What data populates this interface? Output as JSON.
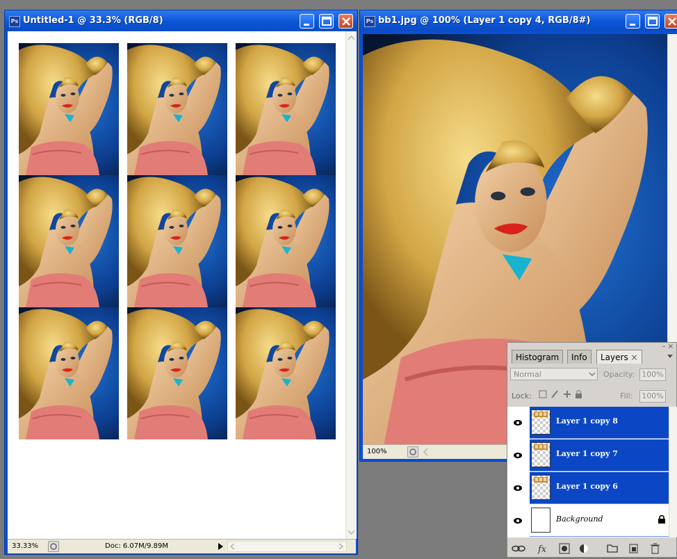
{
  "window_left": {
    "title": "Untitled-1 @ 33.3% (RGB/8)",
    "zoom": "33.33%",
    "doc_info": "Doc: 6.07M/9.89M",
    "grid_rows": 3,
    "grid_cols": 3
  },
  "window_right": {
    "title": "bb1.jpg @ 100% (Layer 1 copy 4, RGB/8#)",
    "zoom": "100%"
  },
  "layers_panel": {
    "tabs": [
      "Histogram",
      "Info",
      "Layers"
    ],
    "active_tab": "Layers",
    "tab_close": "×",
    "blend_mode": "Normal",
    "opacity_label": "Opacity:",
    "opacity_value": "100%",
    "lock_label": "Lock:",
    "fill_label": "Fill:",
    "fill_value": "100%",
    "layers": [
      {
        "name": "Layer 1 copy 8",
        "selected": true
      },
      {
        "name": "Layer 1 copy 7",
        "selected": true
      },
      {
        "name": "Layer 1 copy 6",
        "selected": true
      },
      {
        "name": "Background",
        "selected": false,
        "locked": true
      }
    ],
    "footer_icons": [
      "link-layers-icon",
      "fx-icon",
      "layer-mask-icon",
      "adjustment-layer-icon",
      "group-icon",
      "new-layer-icon",
      "trash-icon"
    ]
  },
  "colors": {
    "title_blue": "#0a55d6",
    "selected_layer": "#0b47c5",
    "panel_bg": "#d6d3ce",
    "desktop_gray": "#7b7b7b"
  }
}
